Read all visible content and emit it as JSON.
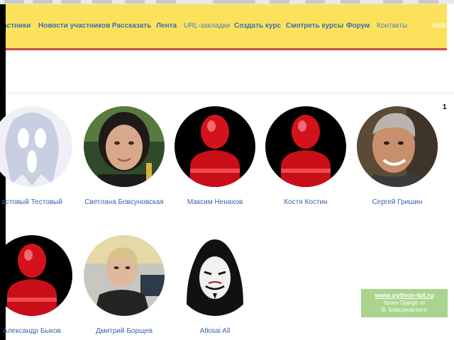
{
  "nav": {
    "items": [
      {
        "label": "астники"
      },
      {
        "label": "Новости участников"
      },
      {
        "label": "Рассказать"
      },
      {
        "label": "Лента"
      },
      {
        "label": "URL-закладки"
      },
      {
        "label": "Создать курс"
      },
      {
        "label": "Смотреть курсы"
      },
      {
        "label": "Форум"
      },
      {
        "label": "Контакты"
      },
      {
        "label": "Hello"
      }
    ]
  },
  "pagination": {
    "current": "1"
  },
  "members": [
    {
      "name": "астовый Тестовый",
      "avatar": "ghost-mask-icon"
    },
    {
      "name": "Светлана Бовсуновская",
      "avatar": "user-photo"
    },
    {
      "name": "Максим Ненахов",
      "avatar": "red-person-icon"
    },
    {
      "name": "Костя Костин",
      "avatar": "red-person-icon"
    },
    {
      "name": "Сергей Гришин",
      "avatar": "user-photo"
    },
    {
      "name": "Александр Быков",
      "avatar": "red-person-icon"
    },
    {
      "name": "Дмитрий Борщев",
      "avatar": "user-photo"
    },
    {
      "name": "Atkisai All",
      "avatar": "anonymous-mask-icon"
    }
  ],
  "watermark": {
    "link": "www.python-tut.ru",
    "line1": "Уроки Django от",
    "line2": "В. Бовсуновского"
  },
  "colors": {
    "navbar_bg": "#fce25c",
    "navbar_border": "#c44b4b",
    "link": "#3b63a8",
    "watermark_bg": "#a9d48c"
  }
}
